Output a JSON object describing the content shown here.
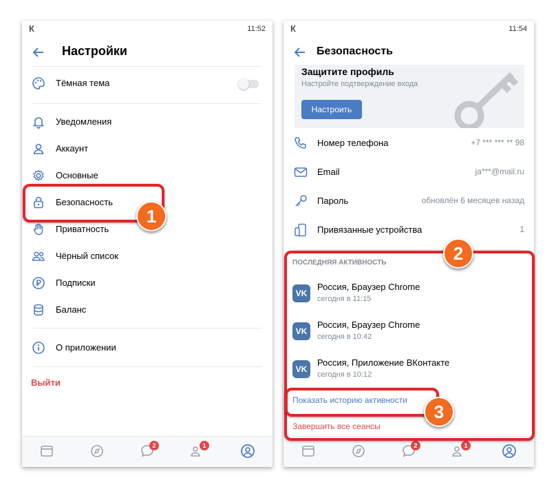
{
  "phone1": {
    "status": {
      "logo": "К",
      "time": "11:52"
    },
    "title": "Настройки",
    "dark_theme_label": "Тёмная тема",
    "items": [
      {
        "label": "Уведомления",
        "icon": "bell-icon"
      },
      {
        "label": "Аккаунт",
        "icon": "user-icon"
      },
      {
        "label": "Основные",
        "icon": "gear-icon"
      },
      {
        "label": "Безопасность",
        "icon": "lock-icon"
      },
      {
        "label": "Приватность",
        "icon": "hand-icon"
      },
      {
        "label": "Чёрный список",
        "icon": "users-icon"
      },
      {
        "label": "Подписки",
        "icon": "ruble-icon"
      },
      {
        "label": "Баланс",
        "icon": "database-icon"
      }
    ],
    "about_label": "О приложении",
    "logout_label": "Выйти",
    "tab_badges": {
      "messages": "2",
      "friends": "1"
    },
    "callout": "1"
  },
  "phone2": {
    "status": {
      "logo": "К",
      "time": "11:54"
    },
    "title": "Безопасность",
    "promo": {
      "title": "Защитите профиль",
      "subtitle": "Настройте подтверждение входа",
      "button": "Настроить"
    },
    "rows": [
      {
        "label": "Номер телефона",
        "value": "+7 *** *** ** 98",
        "icon": "phone-icon"
      },
      {
        "label": "Email",
        "value": "ja***@mail.ru",
        "icon": "mail-icon"
      },
      {
        "label": "Пароль",
        "value": "обновлён 6 месяцев назад",
        "icon": "key-icon"
      },
      {
        "label": "Привязанные устройства",
        "value": "1",
        "icon": "devices-icon"
      }
    ],
    "activity_header": "ПОСЛЕДНЯЯ АКТИВНОСТЬ",
    "activity": [
      {
        "title": "Россия, Браузер Chrome",
        "time": "сегодня в 11:15"
      },
      {
        "title": "Россия, Браузер Chrome",
        "time": "сегодня в 10:42"
      },
      {
        "title": "Россия, Приложение ВКонтакте",
        "time": "сегодня в 10:12"
      }
    ],
    "show_history": "Показать историю активности",
    "end_sessions": "Завершить все сеансы",
    "tab_badges": {
      "messages": "2",
      "friends": "1"
    },
    "callouts": [
      "2",
      "3"
    ]
  },
  "colors": {
    "accent": "#4b7bc4",
    "danger": "#e64646",
    "highlight": "#e3242b",
    "callout": "#f36b1e"
  }
}
